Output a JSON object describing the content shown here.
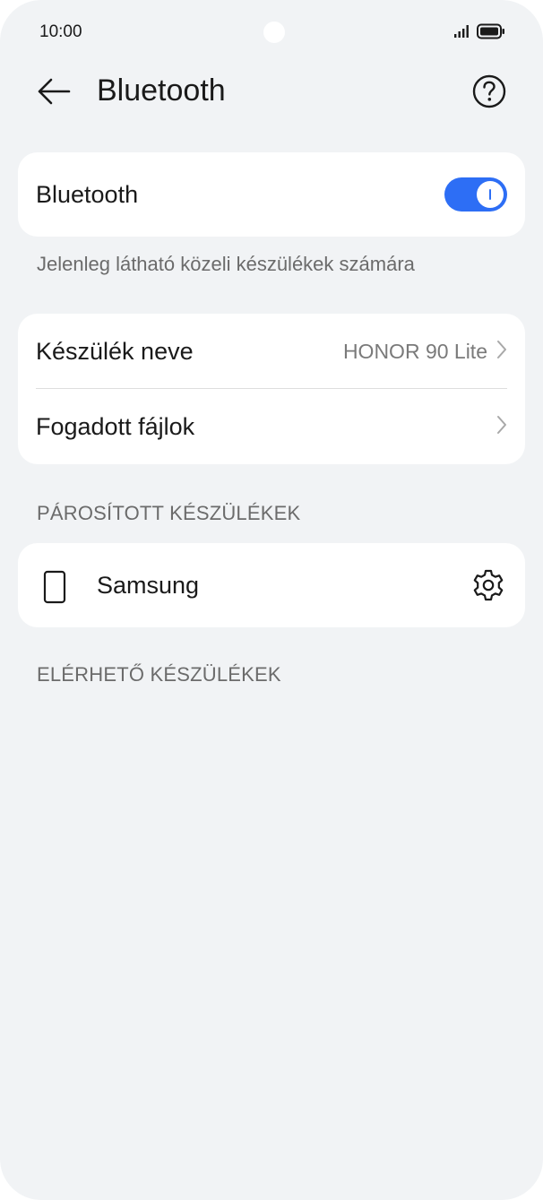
{
  "status_bar": {
    "time": "10:00"
  },
  "header": {
    "title": "Bluetooth",
    "back_icon": "arrow-left-icon",
    "help_icon": "question-circle-icon"
  },
  "bluetooth_card": {
    "label": "Bluetooth",
    "toggle_on": true,
    "accent_color": "#2d6ef5"
  },
  "visibility_caption": "Jelenleg látható közeli készülékek számára",
  "device_card": {
    "name_label": "Készülék neve",
    "name_value": "HONOR 90 Lite",
    "files_label": "Fogadott fájlok"
  },
  "paired_section": {
    "header": "PÁROSÍTOTT KÉSZÜLÉKEK",
    "devices": [
      {
        "name": "Samsung",
        "icon": "phone-icon",
        "action_icon": "gear-icon"
      }
    ]
  },
  "available_section": {
    "header": "ELÉRHETŐ KÉSZÜLÉKEK"
  }
}
